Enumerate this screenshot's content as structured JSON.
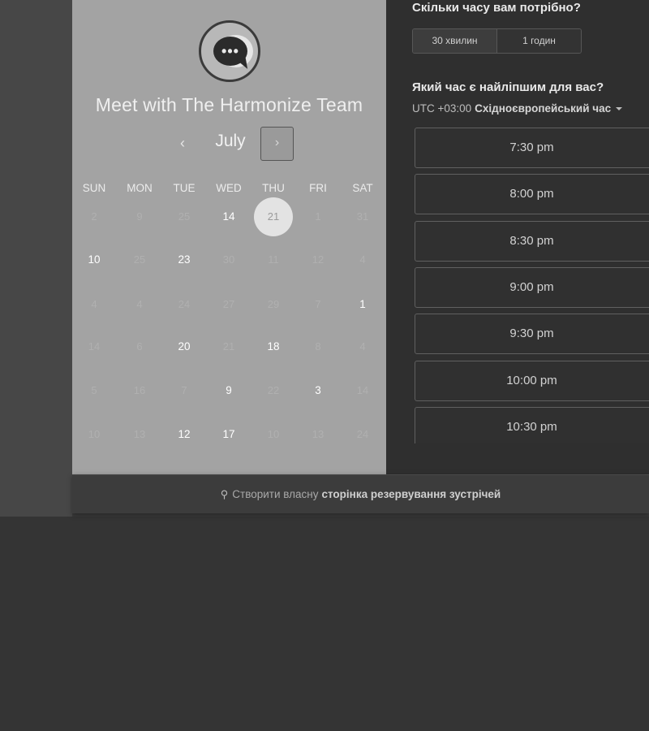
{
  "booking": {
    "team_title": "Meet with The Harmonize Team",
    "logo_icon": "chat-bubble-icon",
    "prev_symbol": "‹",
    "next_symbol": "›",
    "month": "July",
    "weekdays": [
      "SUN",
      "MON",
      "TUE",
      "WED",
      "THU",
      "FRI",
      "SAT"
    ],
    "weeks": [
      [
        {
          "d": "2",
          "s": "muted"
        },
        {
          "d": "9",
          "s": "muted"
        },
        {
          "d": "25",
          "s": "muted"
        },
        {
          "d": "14",
          "s": "avail"
        },
        {
          "d": "21",
          "s": "selected"
        },
        {
          "d": "1",
          "s": "muted"
        },
        {
          "d": "31",
          "s": "muted"
        }
      ],
      [
        {
          "d": "10",
          "s": "avail"
        },
        {
          "d": "25",
          "s": "muted"
        },
        {
          "d": "23",
          "s": "avail"
        },
        {
          "d": "30",
          "s": "muted"
        },
        {
          "d": "11",
          "s": "muted"
        },
        {
          "d": "12",
          "s": "muted"
        },
        {
          "d": "4",
          "s": "muted"
        }
      ],
      [
        {
          "d": "4",
          "s": "muted"
        },
        {
          "d": "4",
          "s": "muted"
        },
        {
          "d": "24",
          "s": "muted"
        },
        {
          "d": "27",
          "s": "muted"
        },
        {
          "d": "29",
          "s": "muted"
        },
        {
          "d": "7",
          "s": "muted"
        },
        {
          "d": "1",
          "s": "avail"
        }
      ],
      [
        {
          "d": "14",
          "s": "muted"
        },
        {
          "d": "6",
          "s": "muted"
        },
        {
          "d": "20",
          "s": "avail"
        },
        {
          "d": "21",
          "s": "muted"
        },
        {
          "d": "18",
          "s": "avail"
        },
        {
          "d": "8",
          "s": "muted"
        },
        {
          "d": "4",
          "s": "muted"
        }
      ],
      [
        {
          "d": "5",
          "s": "muted"
        },
        {
          "d": "16",
          "s": "muted"
        },
        {
          "d": "7",
          "s": "muted"
        },
        {
          "d": "9",
          "s": "avail"
        },
        {
          "d": "22",
          "s": "muted"
        },
        {
          "d": "3",
          "s": "avail"
        },
        {
          "d": "14",
          "s": "muted"
        }
      ],
      [
        {
          "d": "10",
          "s": "muted"
        },
        {
          "d": "13",
          "s": "muted"
        },
        {
          "d": "12",
          "s": "avail"
        },
        {
          "d": "17",
          "s": "avail"
        },
        {
          "d": "10",
          "s": "muted"
        },
        {
          "d": "13",
          "s": "muted"
        },
        {
          "d": "24",
          "s": "muted"
        }
      ]
    ]
  },
  "duration": {
    "title": "Скільки часу вам потрібно?",
    "options": [
      "30 хвилин",
      "1 годин"
    ]
  },
  "time": {
    "title": "Який час є найліпшим для вас?",
    "tz_offset": "UTC +03:00",
    "tz_name": "Східноєвропейський час",
    "slots": [
      "7:30 pm",
      "8:00 pm",
      "8:30 pm",
      "9:00 pm",
      "9:30 pm",
      "10:00 pm",
      "10:30 pm"
    ]
  },
  "footer": {
    "icon": "link-icon",
    "prefix": "Створити власну",
    "bold": "сторінка резервування зустрічей"
  }
}
